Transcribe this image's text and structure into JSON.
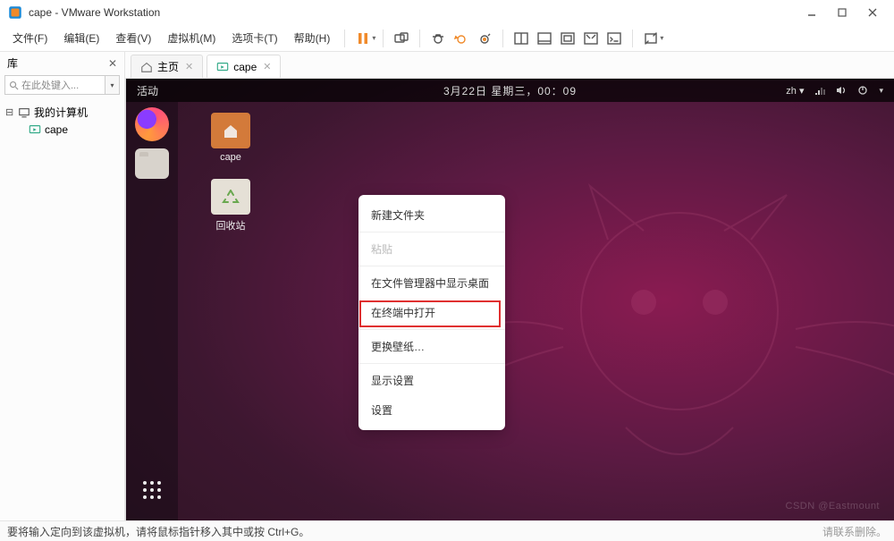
{
  "window": {
    "title": "cape - VMware Workstation"
  },
  "menubar": {
    "items": [
      "文件(F)",
      "编辑(E)",
      "查看(V)",
      "虚拟机(M)",
      "选项卡(T)",
      "帮助(H)"
    ]
  },
  "library": {
    "header": "库",
    "search_placeholder": "在此处键入...",
    "root_label": "我的计算机",
    "vm_label": "cape"
  },
  "tabs": {
    "home_label": "主页",
    "vm_label": "cape"
  },
  "gnome": {
    "activities": "活动",
    "clock": "3月22日 星期三，00：09",
    "lang": "zh"
  },
  "desktop": {
    "home_label": "cape",
    "trash_label": "回收站"
  },
  "context_menu": {
    "new_folder": "新建文件夹",
    "paste": "粘贴",
    "show_desktop_in_files": "在文件管理器中显示桌面",
    "open_terminal": "在终端中打开",
    "change_wallpaper": "更换壁纸…",
    "display_settings": "显示设置",
    "settings": "设置"
  },
  "statusbar": {
    "hint": "要将输入定向到该虚拟机，请将鼠标指针移入其中或按 Ctrl+G。",
    "right": "请联系删除。"
  },
  "watermark": "CSDN @Eastmount",
  "colors": {
    "pause_orange": "#f08a2a",
    "firefox_a": "#ff9a3c",
    "firefox_b": "#ff4f7b",
    "firefox_c": "#8a3cff",
    "folder": "#d37a3a",
    "trash_body": "#e5e0d6",
    "trash_lid": "#69a84f"
  }
}
